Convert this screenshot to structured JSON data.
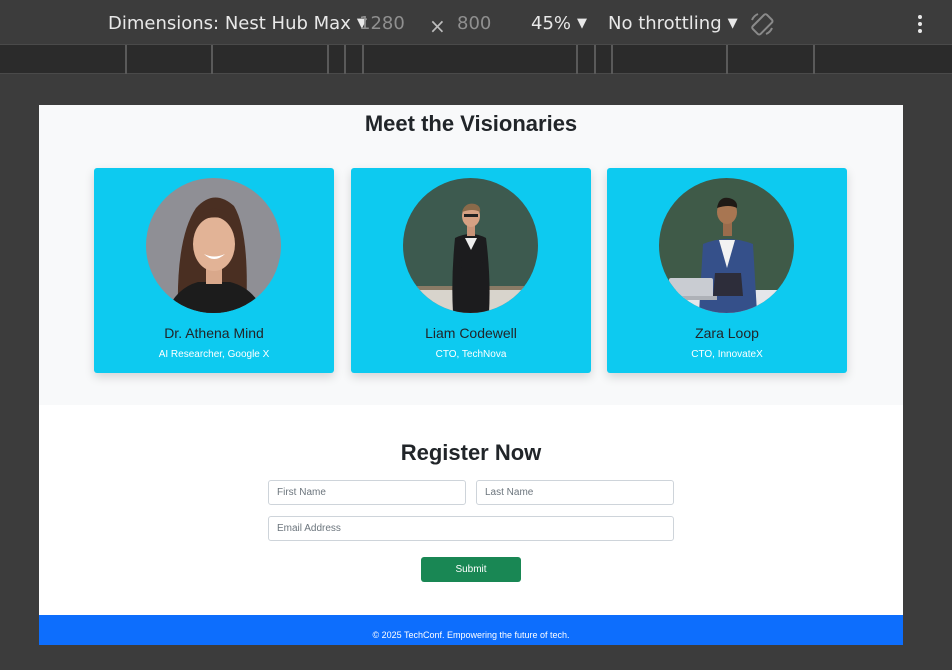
{
  "devtools": {
    "dimensions_label": "Dimensions: Nest Hub Max",
    "width": "1280",
    "times": "×",
    "height": "800",
    "zoom": "45%",
    "throttling": "No throttling"
  },
  "speakers": {
    "title": "Meet the Visionaries",
    "items": [
      {
        "name": "Dr. Athena Mind",
        "role": "AI Researcher, Google X"
      },
      {
        "name": "Liam Codewell",
        "role": "CTO, TechNova"
      },
      {
        "name": "Zara Loop",
        "role": "CTO, InnovateX"
      }
    ]
  },
  "register": {
    "title": "Register Now",
    "first_name_placeholder": "First Name",
    "last_name_placeholder": "Last Name",
    "email_placeholder": "Email Address",
    "submit_label": "Submit"
  },
  "footer": {
    "text": "© 2025 TechConf. Empowering the future of tech."
  },
  "colors": {
    "card": "#0dcaf0",
    "submit": "#198754",
    "footer": "#0d6efd"
  }
}
